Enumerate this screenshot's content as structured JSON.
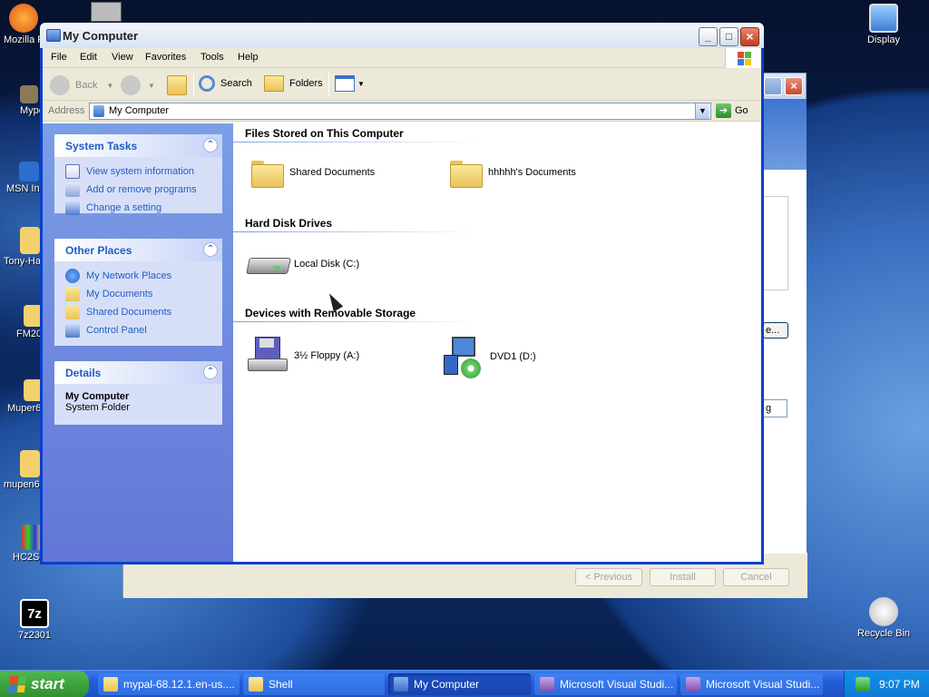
{
  "desktop": {
    "icons": [
      {
        "label": "Mozilla F"
      },
      {
        "label": "Mype"
      },
      {
        "label": "MSN Ins"
      },
      {
        "label": "Tony-Ha"
      },
      {
        "label": "FM20"
      },
      {
        "label": "Muper6"
      },
      {
        "label": "mupen6"
      },
      {
        "label": "HC2Se"
      },
      {
        "label": "7z2301"
      },
      {
        "label": "Display"
      },
      {
        "label": "Recycle Bin"
      }
    ]
  },
  "bg_window": {
    "partial_button": "e...",
    "partial_field": "g",
    "buttons": {
      "previous": "< Previous",
      "install": "Install",
      "cancel": "Cancel"
    }
  },
  "window": {
    "title": "My Computer",
    "menu": [
      "File",
      "Edit",
      "View",
      "Favorites",
      "Tools",
      "Help"
    ],
    "toolbar": {
      "back": "Back",
      "search": "Search",
      "folders": "Folders"
    },
    "address": {
      "label": "Address",
      "value": "My Computer",
      "go": "Go"
    },
    "task_pane": {
      "system_tasks": {
        "title": "System Tasks",
        "items": [
          "View system information",
          "Add or remove programs",
          "Change a setting"
        ]
      },
      "other_places": {
        "title": "Other Places",
        "items": [
          "My Network Places",
          "My Documents",
          "Shared Documents",
          "Control Panel"
        ]
      },
      "details": {
        "title": "Details",
        "name": "My Computer",
        "type": "System Folder"
      }
    },
    "groups": [
      {
        "title": "Files Stored on This Computer",
        "items": [
          "Shared Documents",
          "hhhhh's Documents"
        ]
      },
      {
        "title": "Hard Disk Drives",
        "items": [
          "Local Disk (C:)"
        ]
      },
      {
        "title": "Devices with Removable Storage",
        "items": [
          "3½ Floppy (A:)",
          "DVD1 (D:)"
        ]
      }
    ]
  },
  "taskbar": {
    "start": "start",
    "buttons": [
      {
        "label": "mypal-68.12.1.en-us...."
      },
      {
        "label": "Shell"
      },
      {
        "label": "My Computer"
      },
      {
        "label": "Microsoft Visual Studi..."
      },
      {
        "label": "Microsoft Visual Studi..."
      }
    ],
    "clock": "9:07 PM"
  },
  "colors": {
    "xp_blue": "#0a3fcd",
    "task_pane_blue": "#6376d6",
    "link_blue": "#215dc6",
    "taskbar_blue": "#245edb",
    "start_green": "#2e8f2e"
  }
}
